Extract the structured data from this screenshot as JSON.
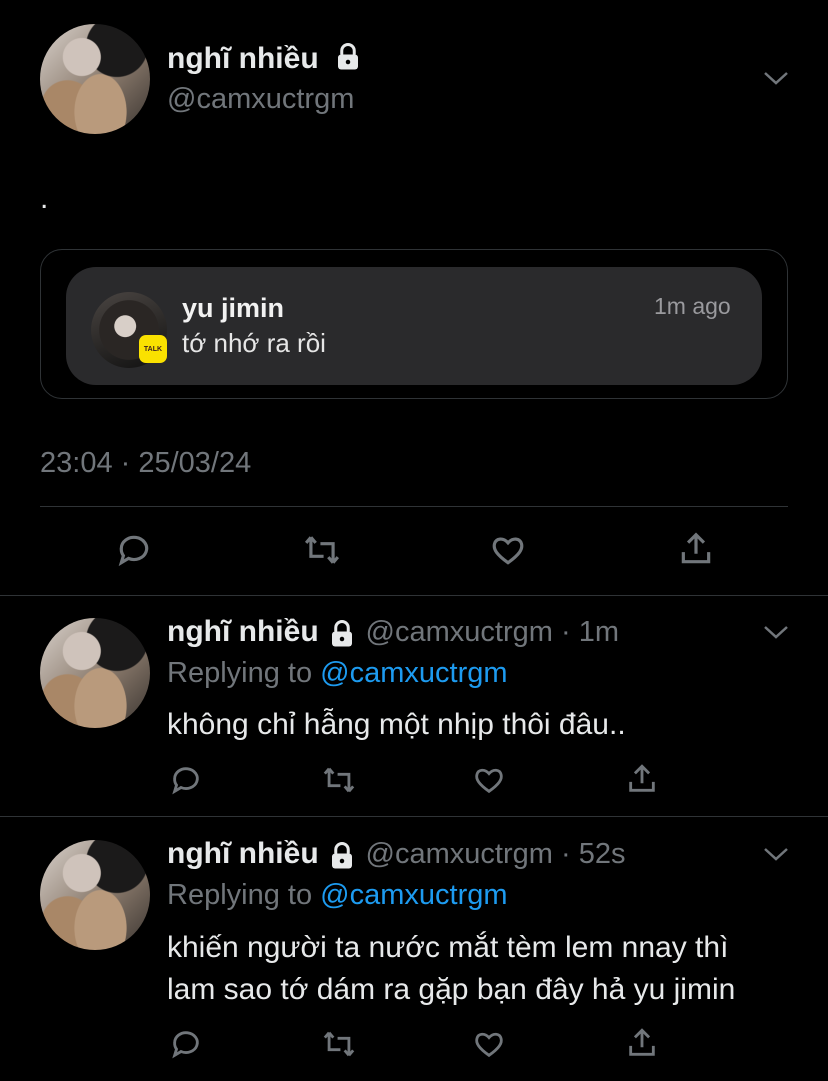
{
  "main_tweet": {
    "display_name": "nghĩ nhiều",
    "handle": "@camxuctrgm",
    "text": ".",
    "notification": {
      "sender": "yu jimin",
      "message": "tớ nhớ ra rồi",
      "time": "1m ago",
      "app_badge": "TALK"
    },
    "timestamp": "23:04 · 25/03/24"
  },
  "replies": [
    {
      "display_name": "nghĩ nhiều",
      "handle": "@camxuctrgm",
      "time": "1m",
      "replying_prefix": "Replying to",
      "replying_to": "@camxuctrgm",
      "text_lines": [
        "không chỉ hẫng một nhịp thôi đâu.."
      ]
    },
    {
      "display_name": "nghĩ nhiều",
      "handle": "@camxuctrgm",
      "time": "52s",
      "replying_prefix": "Replying to",
      "replying_to": "@camxuctrgm",
      "text_lines": [
        "khiến người ta nước mắt tèm lem nnay thì",
        "lam sao tớ dám ra gặp bạn đây hả yu jimin"
      ]
    }
  ],
  "icons": [
    "lock-icon",
    "chevron-down-icon",
    "reply-icon",
    "retweet-icon",
    "like-icon",
    "share-icon"
  ]
}
